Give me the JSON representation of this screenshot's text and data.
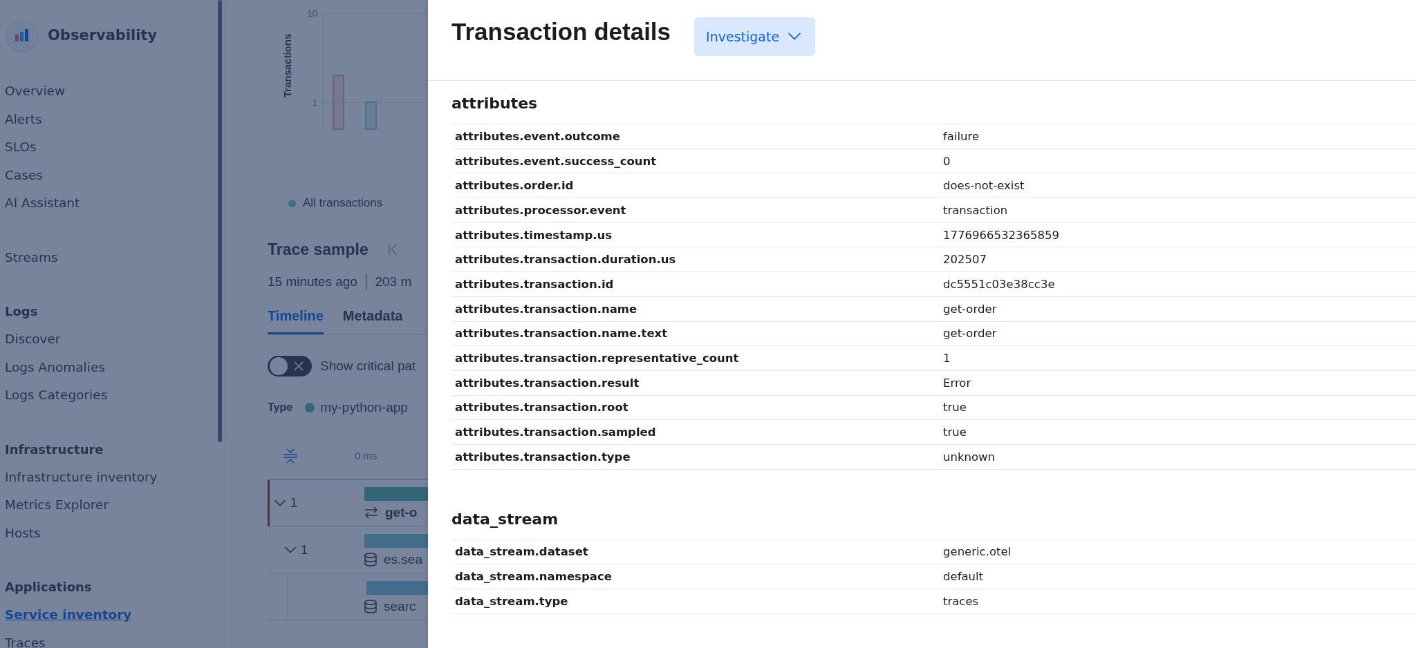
{
  "sidebar": {
    "title": "Observability",
    "groups": [
      {
        "items": [
          {
            "label": "Overview",
            "selected": false
          },
          {
            "label": "Alerts",
            "selected": false
          },
          {
            "label": "SLOs",
            "selected": false
          },
          {
            "label": "Cases",
            "selected": false
          },
          {
            "label": "AI Assistant",
            "selected": false
          }
        ]
      },
      {
        "items": [
          {
            "label": "Streams",
            "selected": false
          }
        ]
      },
      {
        "heading": "Logs",
        "items": [
          {
            "label": "Discover",
            "selected": false
          },
          {
            "label": "Logs Anomalies",
            "selected": false
          },
          {
            "label": "Logs Categories",
            "selected": false
          }
        ]
      },
      {
        "heading": "Infrastructure",
        "items": [
          {
            "label": "Infrastructure inventory",
            "selected": false
          },
          {
            "label": "Metrics Explorer",
            "selected": false
          },
          {
            "label": "Hosts",
            "selected": false
          }
        ]
      },
      {
        "heading": "Applications",
        "items": [
          {
            "label": "Service inventory",
            "selected": true
          },
          {
            "label": "Traces",
            "selected": false
          }
        ]
      }
    ]
  },
  "transactions_chart": {
    "ylabel": "Transactions",
    "ticks": [
      "10",
      "1"
    ],
    "legend": "All transactions"
  },
  "trace_sample": {
    "title": "Trace sample",
    "age": "15 minutes ago",
    "duration": "203 m",
    "tabs": [
      {
        "label": "Timeline",
        "selected": true
      },
      {
        "label": "Metadata",
        "selected": false
      }
    ],
    "critical_path_toggle": {
      "label": "Show critical pat",
      "on": false
    },
    "type_legend": {
      "label": "Type",
      "items": [
        {
          "name": "my-python-app"
        }
      ]
    },
    "timeline_start": "0 ms",
    "waterfall": [
      {
        "count": "1",
        "expanded": true,
        "error": true,
        "kind": "transaction",
        "name": "get-o",
        "children": [
          {
            "count": "1",
            "expanded": true,
            "error": false,
            "kind": "db",
            "name": "es.sea",
            "children": [
              {
                "error": false,
                "kind": "db",
                "name": "searc"
              }
            ]
          }
        ]
      }
    ]
  },
  "flyout": {
    "title": "Transaction details",
    "investigate_button": "Investigate",
    "sections": [
      {
        "title": "attributes",
        "rows": [
          {
            "field": "attributes.event.outcome",
            "value": "failure"
          },
          {
            "field": "attributes.event.success_count",
            "value": "0"
          },
          {
            "field": "attributes.order.id",
            "value": "does-not-exist"
          },
          {
            "field": "attributes.processor.event",
            "value": "transaction"
          },
          {
            "field": "attributes.timestamp.us",
            "value": "1776966532365859"
          },
          {
            "field": "attributes.transaction.duration.us",
            "value": "202507"
          },
          {
            "field": "attributes.transaction.id",
            "value": "dc5551c03e38cc3e"
          },
          {
            "field": "attributes.transaction.name",
            "value": "get-order"
          },
          {
            "field": "attributes.transaction.name.text",
            "value": "get-order"
          },
          {
            "field": "attributes.transaction.representative_count",
            "value": "1"
          },
          {
            "field": "attributes.transaction.result",
            "value": "Error"
          },
          {
            "field": "attributes.transaction.root",
            "value": "true"
          },
          {
            "field": "attributes.transaction.sampled",
            "value": "true"
          },
          {
            "field": "attributes.transaction.type",
            "value": "unknown"
          }
        ]
      },
      {
        "title": "data_stream",
        "rows": [
          {
            "field": "data_stream.dataset",
            "value": "generic.otel"
          },
          {
            "field": "data_stream.namespace",
            "value": "default"
          },
          {
            "field": "data_stream.type",
            "value": "traces"
          }
        ]
      }
    ]
  }
}
